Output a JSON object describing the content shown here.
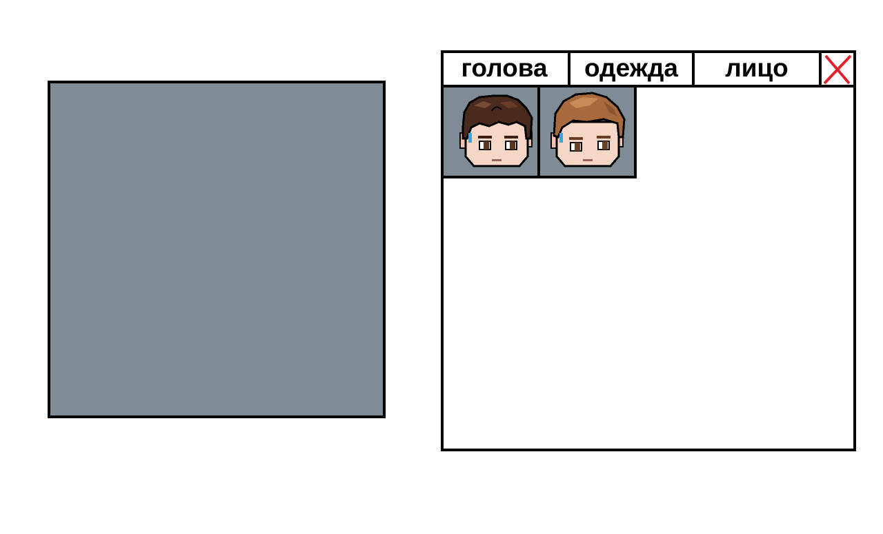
{
  "tabs": [
    {
      "label": "голова"
    },
    {
      "label": "одежда"
    },
    {
      "label": "лицо"
    }
  ],
  "close_icon": "close-x-icon",
  "colors": {
    "preview_bg": "#7f8c95",
    "close_x": "#e0202a",
    "hair_dark": "#4a2a1c",
    "hair_light": "#a8693c",
    "skin": "#f6d6c4"
  },
  "grid_items": [
    {
      "icon": "dark-hair-head-icon"
    },
    {
      "icon": "light-brown-hair-head-icon"
    }
  ]
}
